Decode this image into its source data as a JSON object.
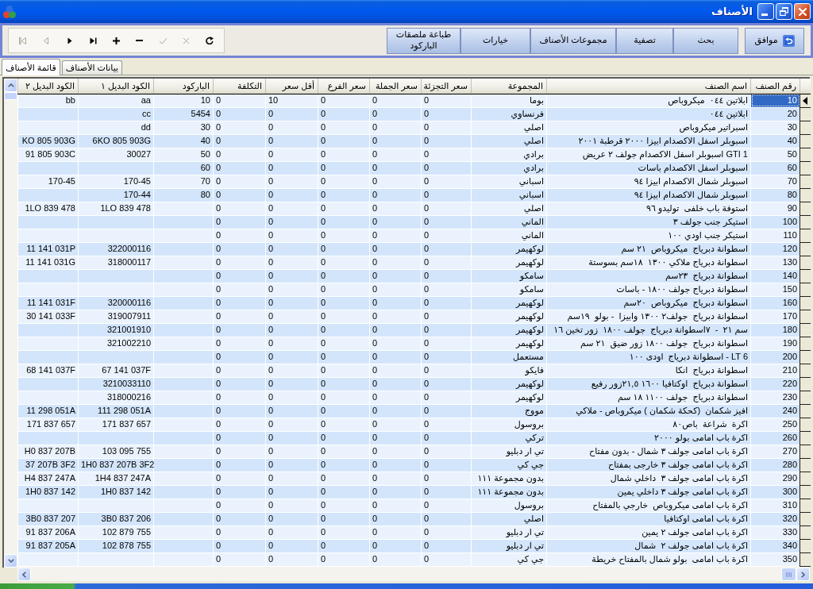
{
  "window": {
    "title": "الأصناف"
  },
  "toolbar": {
    "buttons": [
      {
        "label": "موافق",
        "kind": "icon"
      },
      {
        "label": "بحث",
        "kind": "text"
      },
      {
        "label": "تصفية",
        "kind": "text"
      },
      {
        "label": "مجموعات الأصناف",
        "kind": "text"
      },
      {
        "label": "خيارات",
        "kind": "text"
      },
      {
        "label": "طباعة ملصقات الباركود",
        "kind": "text"
      }
    ],
    "navigator": [
      {
        "kind": "first",
        "disabled": true
      },
      {
        "kind": "previous",
        "disabled": true
      },
      {
        "kind": "next",
        "disabled": false
      },
      {
        "kind": "last",
        "disabled": false
      },
      {
        "kind": "add",
        "disabled": false
      },
      {
        "kind": "remove",
        "disabled": false
      },
      {
        "kind": "confirm",
        "disabled": true
      },
      {
        "kind": "cancel",
        "disabled": true
      },
      {
        "kind": "refresh",
        "disabled": false
      }
    ]
  },
  "tabs": [
    {
      "label": "بيانات الأصناف",
      "selected": false
    },
    {
      "label": "قائمة الأصناف",
      "selected": true
    }
  ],
  "table": {
    "columns": [
      {
        "label": "رقم الصنف",
        "kind": "code"
      },
      {
        "label": "اسم الصنف",
        "kind": "text"
      },
      {
        "label": "المجموعة",
        "kind": "text"
      },
      {
        "label": "سعر التجزئة",
        "kind": "amount"
      },
      {
        "label": "سعر الجملة",
        "kind": "amount"
      },
      {
        "label": "سعر الفرع",
        "kind": "amount"
      },
      {
        "label": "أقل سعر",
        "kind": "amount"
      },
      {
        "label": "التكلفة",
        "kind": "amount"
      },
      {
        "label": "الباركود",
        "kind": "code"
      },
      {
        "label": "الكود البديل ١",
        "kind": "code"
      },
      {
        "label": "الكود البديل ٢",
        "kind": "code"
      }
    ],
    "rows": [
      {
        "selected": true,
        "cells": [
          "10",
          "ابلاتين ٠٤٤  ميكروباص",
          "بوما",
          "0",
          "0",
          "0",
          "10",
          "0",
          "10",
          "aa",
          "bb"
        ]
      },
      {
        "selected": false,
        "cells": [
          "20",
          "ابلاتين ٠٤٤",
          "فرنساوي",
          "0",
          "0",
          "0",
          "0",
          "0",
          "5454",
          "cc",
          null
        ]
      },
      {
        "selected": false,
        "cells": [
          "30",
          "اسبراتير ميكروباص",
          "اصلي",
          "0",
          "0",
          "0",
          "0",
          "0",
          "30",
          "dd",
          null
        ]
      },
      {
        "selected": false,
        "cells": [
          "40",
          "اسبوبلر اسفل الاكصدام ابيزا ٢٠٠٠ قرطبة ٢٠٠١",
          "اصلي",
          "0",
          "0",
          "0",
          "0",
          "0",
          "40",
          "6KO 805 903G",
          "KO 805 903G"
        ]
      },
      {
        "selected": false,
        "cells": [
          "50",
          "GTI 1 اسبوبلر اسفل الاكصدام جولف ٢ عريض",
          "برادي",
          "0",
          "0",
          "0",
          "0",
          "0",
          "50",
          "30027",
          "91 805 903C"
        ]
      },
      {
        "selected": false,
        "cells": [
          "60",
          "اسبوبلر اسفل الاكصدام باسات",
          "برادي",
          "0",
          "0",
          "0",
          "0",
          "0",
          "60",
          null,
          null
        ]
      },
      {
        "selected": false,
        "cells": [
          "70",
          "اسبوبلر شمال الاكصدام ابيزا ٩٤",
          "اسباني",
          "0",
          "0",
          "0",
          "0",
          "0",
          "70",
          "170-45",
          "170-45"
        ]
      },
      {
        "selected": false,
        "cells": [
          "80",
          "اسبوبلر شمال الاكصدام ابيزا ٩٤",
          "اسباني",
          "0",
          "0",
          "0",
          "0",
          "0",
          "80",
          "170-44",
          null
        ]
      },
      {
        "selected": false,
        "cells": [
          "90",
          "استوفة باب خلفى  توليدو ٩٦",
          "اصلي",
          "0",
          "0",
          "0",
          "0",
          "0",
          null,
          "1LO 839 478",
          "1LO 839 478"
        ]
      },
      {
        "selected": false,
        "cells": [
          "100",
          "استيكر جنب جولف ٣",
          "الماني",
          "0",
          "0",
          "0",
          "0",
          "0",
          null,
          null,
          null
        ]
      },
      {
        "selected": false,
        "cells": [
          "110",
          "استيكر جنب اودي ١٠٠",
          "الماني",
          "0",
          "0",
          "0",
          "0",
          "0",
          null,
          null,
          null
        ]
      },
      {
        "selected": false,
        "cells": [
          "120",
          "اسطوانة دبرياج  ميكروباص  ٢١ سم",
          "لوكهيمر",
          "0",
          "0",
          "0",
          "0",
          "0",
          null,
          "322000116",
          "11 141 031P"
        ]
      },
      {
        "selected": false,
        "cells": [
          "130",
          "اسطوانة دبرياج ملاكي ١٣٠٠  ١٨سم بسوستة",
          "لوكهيمر",
          "0",
          "0",
          "0",
          "0",
          "0",
          null,
          "318000117",
          "11 141 031G"
        ]
      },
      {
        "selected": false,
        "cells": [
          "140",
          "اسطوانة دبرياج  ٢٣سم",
          "سامكو",
          "0",
          "0",
          "0",
          "0",
          "0",
          null,
          null,
          null
        ]
      },
      {
        "selected": false,
        "cells": [
          "150",
          "اسطوانة دبرياج جولف ١٨٠٠ - باسات",
          "سامكو",
          "0",
          "0",
          "0",
          "0",
          "0",
          null,
          null,
          null
        ]
      },
      {
        "selected": false,
        "cells": [
          "160",
          "اسطوانة دبرياج  ميكروباص  ٢٠سم",
          "لوكهيمر",
          "0",
          "0",
          "0",
          "0",
          "0",
          null,
          "320000116",
          "11 141 031F"
        ]
      },
      {
        "selected": false,
        "cells": [
          "170",
          "اسطوانة دبرياج  جولف٢ ١٣٠٠ وابيزا  - بولو  ١٩سم",
          "لوكهيمر",
          "0",
          "0",
          "0",
          "0",
          "0",
          null,
          "319007911",
          "30 141 033F"
        ]
      },
      {
        "selected": false,
        "cells": [
          "180",
          "سم ٢١  -  ٧اسطوانة دبرياج  جولف ١٨٠٠  زور تخين ١٦",
          "لوكهيمر",
          "0",
          "0",
          "0",
          "0",
          "0",
          null,
          "321001910",
          null
        ]
      },
      {
        "selected": false,
        "cells": [
          "190",
          "اسطوانة دبرياج  جولف ١٨٠٠ زور ضيق  ٢١ سم",
          "لوكهيمر",
          "0",
          "0",
          "0",
          "0",
          "0",
          null,
          "321002210",
          null
        ]
      },
      {
        "selected": false,
        "cells": [
          "200",
          "LT 6 - اسطوانة دبرياج  اودى ١٠٠",
          "مستعمل",
          "0",
          "0",
          "0",
          "0",
          "0",
          null,
          null,
          null
        ]
      },
      {
        "selected": false,
        "cells": [
          "210",
          "اسطوانة دبرياج  انكا",
          "فايكو",
          "0",
          "0",
          "0",
          "0",
          "0",
          null,
          "67 141 037F",
          "68 141 037F"
        ]
      },
      {
        "selected": false,
        "cells": [
          "220",
          "اسطوانة دبرياج  اوكتافيا ١٦٠٠ ٢١,٥زور رفيع",
          "لوكهيمر",
          "0",
          "0",
          "0",
          "0",
          "0",
          null,
          "3210033110",
          null
        ]
      },
      {
        "selected": false,
        "cells": [
          "230",
          "اسطوانة دبرياج  جولف ١١٠٠ ١٨ سم",
          "لوكهيمر",
          "0",
          "0",
          "0",
          "0",
          "0",
          null,
          "318000216",
          null
        ]
      },
      {
        "selected": false,
        "cells": [
          "240",
          "افيز شكمان  (كحكة شكمان ) ميكروباص - ملاكي",
          "مووج",
          "0",
          "0",
          "0",
          "0",
          "0",
          null,
          "111 298 051A",
          "11 298 051A"
        ]
      },
      {
        "selected": false,
        "cells": [
          "250",
          "اكرة  شراعة  باص٨٠",
          "بروسول",
          "0",
          "0",
          "0",
          "0",
          "0",
          null,
          "171 837 657",
          "171 837 657"
        ]
      },
      {
        "selected": false,
        "cells": [
          "260",
          "اكرة باب امامى بولو ٢٠٠٠",
          "تركي",
          "0",
          "0",
          "0",
          "0",
          "0",
          null,
          null,
          null
        ]
      },
      {
        "selected": false,
        "cells": [
          "270",
          "اكرة باب امامى جولف ٣ شمال - بدون مفتاح",
          "تي ار دبليو",
          "0",
          "0",
          "0",
          "0",
          "0",
          null,
          "103 095 755",
          "H0 837 207B"
        ]
      },
      {
        "selected": false,
        "cells": [
          "280",
          "اكرة باب امامى جولف ٣ خارجى بمفتاح",
          "جي كي",
          "0",
          "0",
          "0",
          "0",
          "0",
          null,
          "1H0 837 207B 3F2",
          "37 207B 3F2"
        ]
      },
      {
        "selected": false,
        "cells": [
          "290",
          "اكرة باب امامى جولف ٣  داخلي شمال",
          "بدون مجموعة ١١١",
          "0",
          "0",
          "0",
          "0",
          "0",
          null,
          "1H4 837 247A",
          "H4 837 247A"
        ]
      },
      {
        "selected": false,
        "cells": [
          "300",
          "اكرة باب امامى جولف ٣ داخلي يمين",
          "بدون مجموعة ١١١",
          "0",
          "0",
          "0",
          "0",
          "0",
          null,
          "1H0 837 142",
          "1H0 837 142"
        ]
      },
      {
        "selected": false,
        "cells": [
          "310",
          "اكرة باب امامى ميكروباص  خارجي بالمفتاح",
          "بروسول",
          "0",
          "0",
          "0",
          "0",
          "0",
          null,
          null,
          null
        ]
      },
      {
        "selected": false,
        "cells": [
          "320",
          "اكرة باب امامى اوكتافيا",
          "اصلي",
          "0",
          "0",
          "0",
          "0",
          "0",
          null,
          "3B0 837 206",
          "3B0 837 207"
        ]
      },
      {
        "selected": false,
        "cells": [
          "330",
          "اكرة باب امامى جولف ٢ يمين",
          "تي ار دبليو",
          "0",
          "0",
          "0",
          "0",
          "0",
          null,
          "102 879 755",
          "91 837 206A"
        ]
      },
      {
        "selected": false,
        "cells": [
          "340",
          "اكرة باب امامى جولف ٢  شمال",
          "تي ار دبليو",
          "0",
          "0",
          "0",
          "0",
          "0",
          null,
          "102 878 755",
          "91 837 205A"
        ]
      },
      {
        "selected": false,
        "cells": [
          "350",
          "اكرة باب امامى  بولو شمال بالمفتاح خريطة",
          "جي كي",
          "0",
          "0",
          "0",
          "0",
          "0",
          null,
          null,
          null
        ]
      }
    ]
  }
}
